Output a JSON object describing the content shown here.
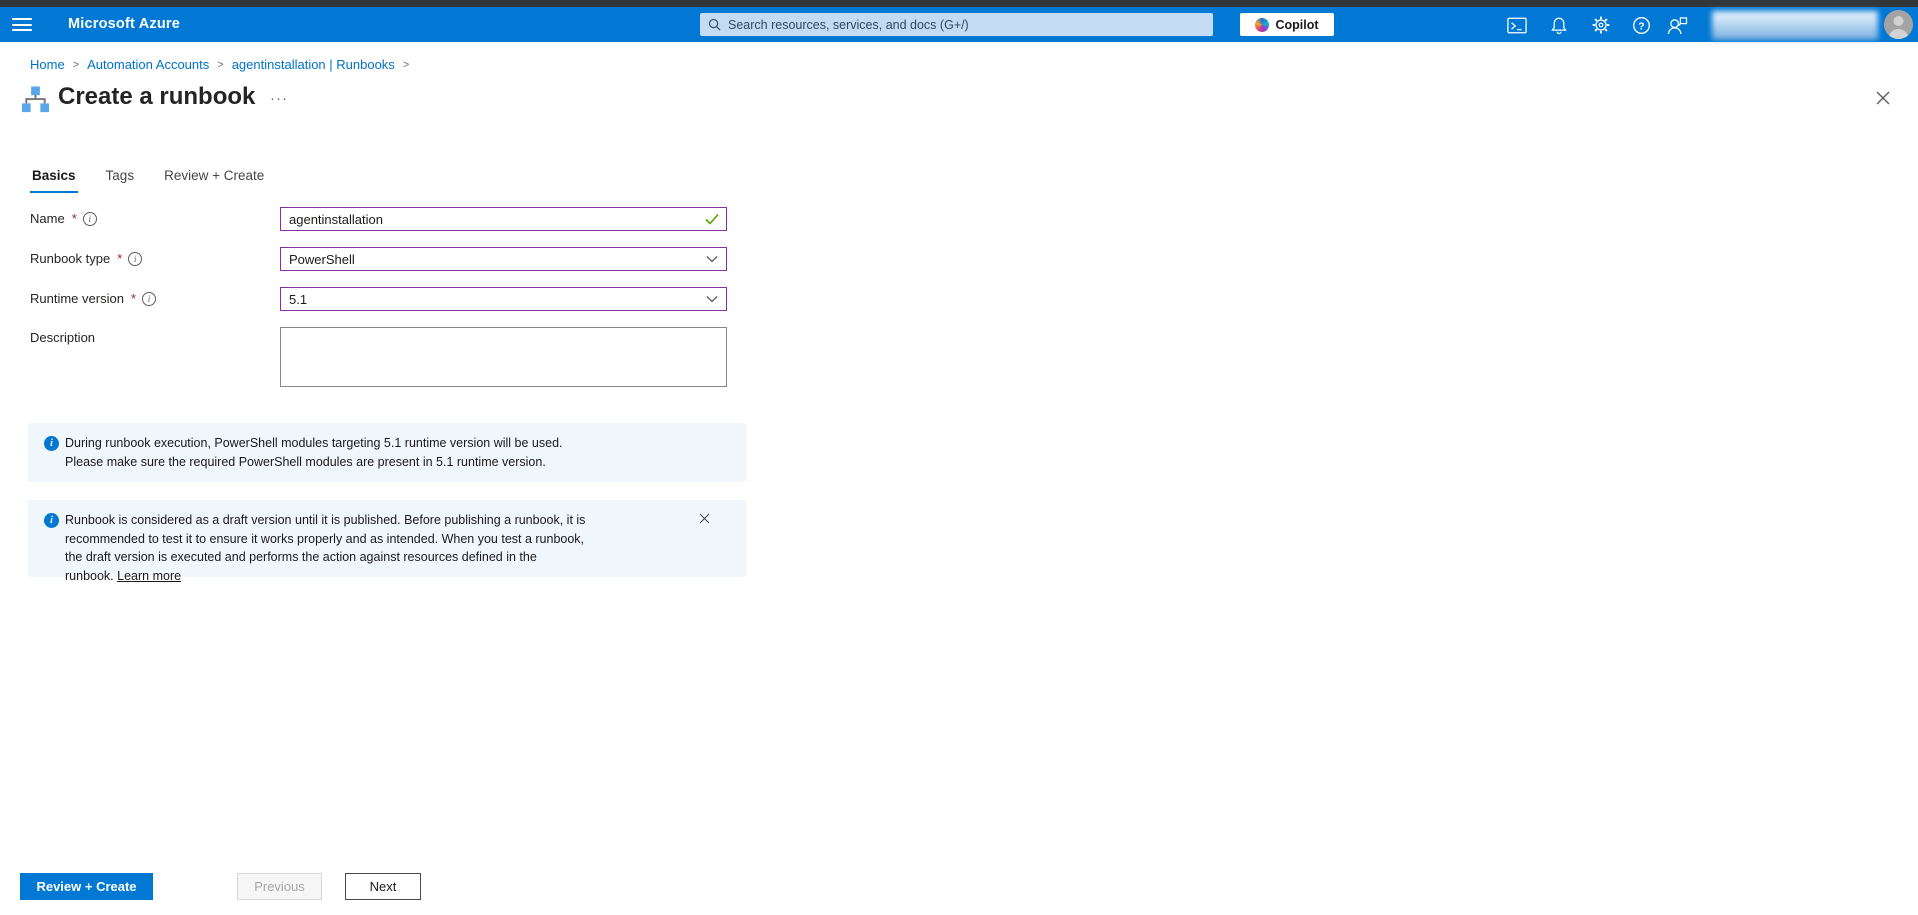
{
  "topbar": {
    "brand": "Microsoft Azure",
    "search_placeholder": "Search resources, services, and docs (G+/)",
    "copilot_label": "Copilot"
  },
  "breadcrumb": {
    "separator": ">",
    "items": [
      "Home",
      "Automation Accounts",
      "agentinstallation | Runbooks"
    ]
  },
  "page": {
    "title": "Create a runbook",
    "more_glyph": "···"
  },
  "tabs": [
    {
      "label": "Basics"
    },
    {
      "label": "Tags"
    },
    {
      "label": "Review + Create"
    }
  ],
  "glyphs": {
    "required": "*",
    "info": "i",
    "question": "?"
  },
  "form": {
    "name": {
      "label": "Name",
      "value": "agentinstallation"
    },
    "runbook_type": {
      "label": "Runbook type",
      "value": "PowerShell"
    },
    "runtime_version": {
      "label": "Runtime version",
      "value": "5.1"
    },
    "description": {
      "label": "Description",
      "value": ""
    }
  },
  "banners": [
    {
      "text": "During runbook execution, PowerShell modules targeting 5.1 runtime version will be used. Please make sure the required PowerShell modules are present in 5.1 runtime version."
    },
    {
      "text": "Runbook is considered as a draft version until it is published. Before publishing a runbook, it is recommended to test it to ensure it works properly and as intended. When you test a runbook, the draft version is executed and performs the action against resources defined in the runbook.",
      "link_label": "Learn more"
    }
  ],
  "footer": {
    "review_create_label": "Review + Create",
    "previous_label": "Previous",
    "next_label": "Next"
  },
  "colors": {
    "topbar": "#0078d4",
    "accent": "#0078d4",
    "input_border": "#8a2da5",
    "valid_check": "#57a300",
    "required": "#a4262c",
    "banner_bg": "#eff6fc"
  }
}
